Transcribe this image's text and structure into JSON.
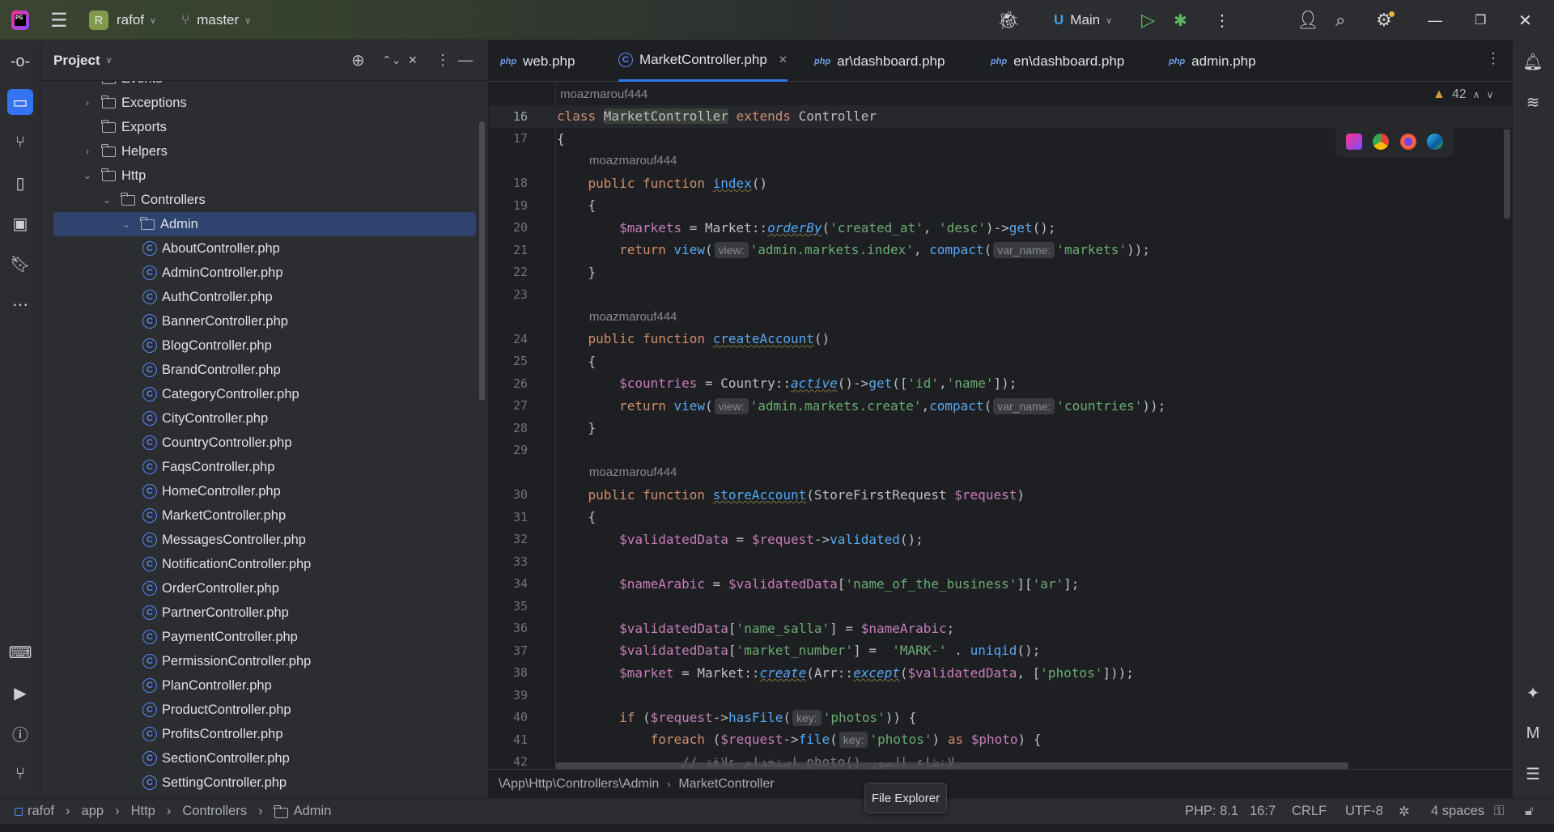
{
  "colors": {
    "accent": "#3574f0",
    "selection": "#2e436e",
    "keyword": "#cf8e6d",
    "string": "#6aab73",
    "function": "#56a8f5",
    "variable": "#c77dbb"
  },
  "titlebar": {
    "project_initial": "R",
    "project_name": "rafof",
    "branch": "master",
    "run_config": "Main"
  },
  "project_panel": {
    "title": "Project"
  },
  "tree": [
    {
      "label": "Events",
      "level": 1,
      "type": "folder",
      "chevron": ">"
    },
    {
      "label": "Exceptions",
      "level": 1,
      "type": "folder",
      "chevron": ">"
    },
    {
      "label": "Exports",
      "level": 1,
      "type": "folder",
      "chevron": ""
    },
    {
      "label": "Helpers",
      "level": 1,
      "type": "folder",
      "chevron": ">"
    },
    {
      "label": "Http",
      "level": 1,
      "type": "folder",
      "chevron": "v"
    },
    {
      "label": "Controllers",
      "level": 2,
      "type": "folder",
      "chevron": "v"
    },
    {
      "label": "Admin",
      "level": 3,
      "type": "folder",
      "chevron": "v",
      "selected": true
    },
    {
      "label": "AboutController.php",
      "level": 4,
      "type": "class"
    },
    {
      "label": "AdminController.php",
      "level": 4,
      "type": "class"
    },
    {
      "label": "AuthController.php",
      "level": 4,
      "type": "class"
    },
    {
      "label": "BannerController.php",
      "level": 4,
      "type": "class"
    },
    {
      "label": "BlogController.php",
      "level": 4,
      "type": "class"
    },
    {
      "label": "BrandController.php",
      "level": 4,
      "type": "class"
    },
    {
      "label": "CategoryController.php",
      "level": 4,
      "type": "class"
    },
    {
      "label": "CityController.php",
      "level": 4,
      "type": "class"
    },
    {
      "label": "CountryController.php",
      "level": 4,
      "type": "class"
    },
    {
      "label": "FaqsController.php",
      "level": 4,
      "type": "class"
    },
    {
      "label": "HomeController.php",
      "level": 4,
      "type": "class"
    },
    {
      "label": "MarketController.php",
      "level": 4,
      "type": "class"
    },
    {
      "label": "MessagesController.php",
      "level": 4,
      "type": "class"
    },
    {
      "label": "NotificationController.php",
      "level": 4,
      "type": "class"
    },
    {
      "label": "OrderController.php",
      "level": 4,
      "type": "class"
    },
    {
      "label": "PartnerController.php",
      "level": 4,
      "type": "class"
    },
    {
      "label": "PaymentController.php",
      "level": 4,
      "type": "class"
    },
    {
      "label": "PermissionController.php",
      "level": 4,
      "type": "class"
    },
    {
      "label": "PlanController.php",
      "level": 4,
      "type": "class"
    },
    {
      "label": "ProductController.php",
      "level": 4,
      "type": "class"
    },
    {
      "label": "ProfitsController.php",
      "level": 4,
      "type": "class"
    },
    {
      "label": "SectionController.php",
      "level": 4,
      "type": "class"
    },
    {
      "label": "SettingController.php",
      "level": 4,
      "type": "class"
    }
  ],
  "tabs": [
    {
      "label": "web.php",
      "icon": "php"
    },
    {
      "label": "MarketController.php",
      "icon": "class",
      "active": true
    },
    {
      "label": "ar\\dashboard.php",
      "icon": "php"
    },
    {
      "label": "en\\dashboard.php",
      "icon": "php"
    },
    {
      "label": "admin.php",
      "icon": "php"
    }
  ],
  "editor": {
    "warnings": "42",
    "top_author": "moazmarouf444",
    "rows": [
      {
        "n": "16",
        "cur": true,
        "t": [
          [
            "k",
            "class "
          ],
          [
            "cls",
            "MarketController"
          ],
          [
            "k",
            " extends "
          ],
          [
            "p",
            "Controller"
          ]
        ]
      },
      {
        "n": "17",
        "t": [
          [
            "p",
            "{"
          ]
        ]
      },
      {
        "author": "moazmarouf444",
        "indent": 4
      },
      {
        "n": "18",
        "t": [
          [
            "k",
            "    public function "
          ],
          [
            "fu",
            "index"
          ],
          [
            "p",
            "()"
          ]
        ]
      },
      {
        "n": "19",
        "t": [
          [
            "p",
            "    {"
          ]
        ]
      },
      {
        "n": "20",
        "t": [
          [
            "v",
            "        $markets"
          ],
          [
            "p",
            " = Market::"
          ],
          [
            "fi",
            "orderBy"
          ],
          [
            "p",
            "("
          ],
          [
            "s",
            "'created_at'"
          ],
          [
            "p",
            ", "
          ],
          [
            "s",
            "'desc'"
          ],
          [
            "p",
            ")->"
          ],
          [
            "f",
            "get"
          ],
          [
            "p",
            "();"
          ]
        ]
      },
      {
        "n": "21",
        "t": [
          [
            "k",
            "        return "
          ],
          [
            "f",
            "view"
          ],
          [
            "p",
            "("
          ],
          [
            "h",
            "view:"
          ],
          [
            "s",
            "'admin.markets.index'"
          ],
          [
            "p",
            ", "
          ],
          [
            "f",
            "compact"
          ],
          [
            "p",
            "("
          ],
          [
            "h",
            "var_name:"
          ],
          [
            "s",
            "'markets'"
          ],
          [
            "p",
            "));"
          ]
        ]
      },
      {
        "n": "22",
        "t": [
          [
            "p",
            "    }"
          ]
        ]
      },
      {
        "n": "23",
        "t": []
      },
      {
        "author": "moazmarouf444",
        "indent": 4
      },
      {
        "n": "24",
        "t": [
          [
            "k",
            "    public function "
          ],
          [
            "fu",
            "createAccount"
          ],
          [
            "p",
            "()"
          ]
        ]
      },
      {
        "n": "25",
        "t": [
          [
            "p",
            "    {"
          ]
        ]
      },
      {
        "n": "26",
        "t": [
          [
            "v",
            "        $countries"
          ],
          [
            "p",
            " = Country::"
          ],
          [
            "fi",
            "active"
          ],
          [
            "p",
            "()->"
          ],
          [
            "f",
            "get"
          ],
          [
            "p",
            "(["
          ],
          [
            "s",
            "'id'"
          ],
          [
            "p",
            ","
          ],
          [
            "s",
            "'name'"
          ],
          [
            "p",
            "]);"
          ]
        ]
      },
      {
        "n": "27",
        "t": [
          [
            "k",
            "        return "
          ],
          [
            "f",
            "view"
          ],
          [
            "p",
            "("
          ],
          [
            "h",
            "view:"
          ],
          [
            "s",
            "'admin.markets.create'"
          ],
          [
            "p",
            ","
          ],
          [
            "f",
            "compact"
          ],
          [
            "p",
            "("
          ],
          [
            "h",
            "var_name:"
          ],
          [
            "s",
            "'countries'"
          ],
          [
            "p",
            "));"
          ]
        ]
      },
      {
        "n": "28",
        "t": [
          [
            "p",
            "    }"
          ]
        ]
      },
      {
        "n": "29",
        "t": []
      },
      {
        "author": "moazmarouf444",
        "indent": 4
      },
      {
        "n": "30",
        "t": [
          [
            "k",
            "    public function "
          ],
          [
            "fu",
            "storeAccount"
          ],
          [
            "p",
            "(StoreFirstRequest "
          ],
          [
            "v",
            "$request"
          ],
          [
            "p",
            ")"
          ]
        ]
      },
      {
        "n": "31",
        "t": [
          [
            "p",
            "    {"
          ]
        ]
      },
      {
        "n": "32",
        "t": [
          [
            "v",
            "        $validatedData"
          ],
          [
            "p",
            " = "
          ],
          [
            "v",
            "$request"
          ],
          [
            "p",
            "->"
          ],
          [
            "f",
            "validated"
          ],
          [
            "p",
            "();"
          ]
        ]
      },
      {
        "n": "33",
        "t": []
      },
      {
        "n": "34",
        "t": [
          [
            "v",
            "        $nameArabic"
          ],
          [
            "p",
            " = "
          ],
          [
            "v",
            "$validatedData"
          ],
          [
            "p",
            "["
          ],
          [
            "s",
            "'name_of_the_business'"
          ],
          [
            "p",
            "]["
          ],
          [
            "s",
            "'ar'"
          ],
          [
            "p",
            "];"
          ]
        ]
      },
      {
        "n": "35",
        "t": []
      },
      {
        "n": "36",
        "t": [
          [
            "v",
            "        $validatedData"
          ],
          [
            "p",
            "["
          ],
          [
            "s",
            "'name_salla'"
          ],
          [
            "p",
            "] = "
          ],
          [
            "v",
            "$nameArabic"
          ],
          [
            "p",
            ";"
          ]
        ]
      },
      {
        "n": "37",
        "t": [
          [
            "v",
            "        $validatedData"
          ],
          [
            "p",
            "["
          ],
          [
            "s",
            "'market_number'"
          ],
          [
            "p",
            "] =  "
          ],
          [
            "s",
            "'MARK-'"
          ],
          [
            "p",
            " . "
          ],
          [
            "f",
            "uniqid"
          ],
          [
            "p",
            "();"
          ]
        ]
      },
      {
        "n": "38",
        "t": [
          [
            "v",
            "        $market"
          ],
          [
            "p",
            " = Market::"
          ],
          [
            "fi",
            "create"
          ],
          [
            "p",
            "(Arr::"
          ],
          [
            "fi",
            "except"
          ],
          [
            "p",
            "("
          ],
          [
            "v",
            "$validatedData"
          ],
          [
            "p",
            ", ["
          ],
          [
            "s",
            "'photos'"
          ],
          [
            "p",
            "]));"
          ]
        ]
      },
      {
        "n": "39",
        "t": []
      },
      {
        "n": "40",
        "t": [
          [
            "k",
            "        if "
          ],
          [
            "p",
            "("
          ],
          [
            "v",
            "$request"
          ],
          [
            "p",
            "->"
          ],
          [
            "f",
            "hasFile"
          ],
          [
            "p",
            "("
          ],
          [
            "h",
            "key:"
          ],
          [
            "s",
            "'photos'"
          ],
          [
            "p",
            ")) {"
          ]
        ]
      },
      {
        "n": "41",
        "t": [
          [
            "k",
            "            foreach "
          ],
          [
            "p",
            "("
          ],
          [
            "v",
            "$request"
          ],
          [
            "p",
            "->"
          ],
          [
            "f",
            "file"
          ],
          [
            "p",
            "("
          ],
          [
            "h",
            "key:"
          ],
          [
            "s",
            "'photos'"
          ],
          [
            "p",
            ") "
          ],
          [
            "k",
            "as "
          ],
          [
            "v",
            "$photo"
          ],
          [
            "p",
            ") {"
          ]
        ]
      },
      {
        "n": "42",
        "t": [
          [
            "c",
            "                // استخدام علاقة photo() لإنشاء الصور"
          ]
        ]
      }
    ]
  },
  "editor_breadcrumb": [
    "\\App\\Http\\Controllers\\Admin",
    "MarketController"
  ],
  "tooltip": "File Explorer",
  "status": {
    "path": [
      "rafof",
      "app",
      "Http",
      "Controllers",
      "Admin"
    ],
    "php": "PHP: 8.1",
    "position": "16:7",
    "line_ending": "CRLF",
    "encoding": "UTF-8",
    "indent": "4 spaces"
  }
}
